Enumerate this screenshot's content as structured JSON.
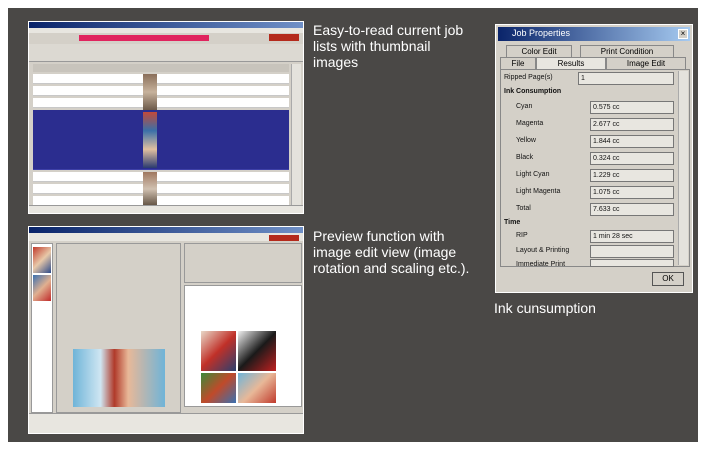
{
  "captions": {
    "job_list": "Easy-to-read current job lists with thumbnail images",
    "preview": "Preview function with image edit view (image rotation and scaling etc.).",
    "ink": "Ink cunsumption"
  },
  "job_properties": {
    "title": "Job Properties",
    "tabs_top": [
      "Color Edit",
      "Print Condition"
    ],
    "tabs_bottom": [
      "File",
      "Results",
      "Image Edit"
    ],
    "ripped_pages_label": "Ripped Page(s)",
    "ripped_pages_value": "1",
    "ink_section": "Ink Consumption",
    "ink_rows": [
      {
        "label": "Cyan",
        "value": "0.575 cc"
      },
      {
        "label": "Magenta",
        "value": "2.677 cc"
      },
      {
        "label": "Yellow",
        "value": "1.844 cc"
      },
      {
        "label": "Black",
        "value": "0.324 cc"
      },
      {
        "label": "Light Cyan",
        "value": "1.229 cc"
      },
      {
        "label": "Light Magenta",
        "value": "1.075 cc"
      },
      {
        "label": "Total",
        "value": "7.633 cc"
      }
    ],
    "time_section": "Time",
    "time_rows": [
      {
        "label": "RIP",
        "value": "1 min 28 sec"
      },
      {
        "label": "Layout & Printing",
        "value": ""
      },
      {
        "label": "Immediate Print",
        "value": ""
      }
    ],
    "ok_label": "OK"
  },
  "colors": {
    "panel_bg": "#4a4846",
    "selection": "#2b2d8f",
    "window_chrome": "#d4d0c8",
    "progress": "#e0245e"
  }
}
